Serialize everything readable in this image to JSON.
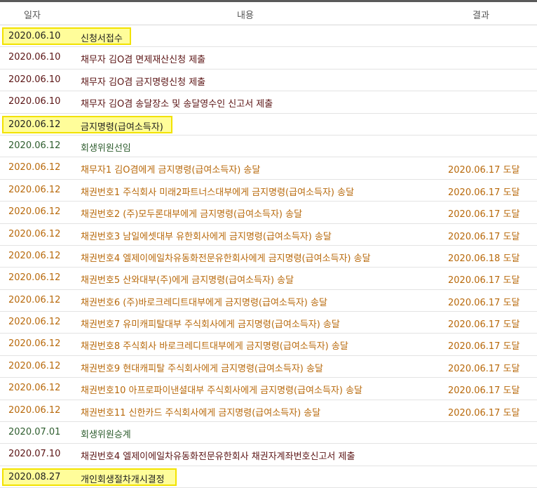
{
  "header": {
    "date": "일자",
    "content": "내용",
    "result": "결과"
  },
  "rows": [
    {
      "date": "2020.06.10",
      "content": "신청서접수",
      "result": "",
      "type": "hl"
    },
    {
      "date": "2020.06.10",
      "content": "채무자 김O겸 면제재산신청 제출",
      "result": "",
      "type": "dark"
    },
    {
      "date": "2020.06.10",
      "content": "채무자 김O겸 금지명령신청 제출",
      "result": "",
      "type": "dark"
    },
    {
      "date": "2020.06.10",
      "content": "채무자 김O겸 송달장소 및 송달영수인 신고서 제출",
      "result": "",
      "type": "dark"
    },
    {
      "date": "2020.06.12",
      "content": "금지명령(급여소득자)",
      "result": "",
      "type": "hl"
    },
    {
      "date": "2020.06.12",
      "content": "회생위원선임",
      "result": "",
      "type": "green"
    },
    {
      "date": "2020.06.12",
      "content": "채무자1 김O겸에게 금지명령(급여소득자) 송달",
      "result": "2020.06.17 도달",
      "type": "orange"
    },
    {
      "date": "2020.06.12",
      "content": "채권번호1 주식회사 미래2파트너스대부에게 금지명령(급여소득자) 송달",
      "result": "2020.06.17 도달",
      "type": "orange"
    },
    {
      "date": "2020.06.12",
      "content": "채권번호2 (주)모두론대부에게 금지명령(급여소득자) 송달",
      "result": "2020.06.17 도달",
      "type": "orange"
    },
    {
      "date": "2020.06.12",
      "content": "채권번호3 남일에셋대부 유한회사에게 금지명령(급여소득자) 송달",
      "result": "2020.06.17 도달",
      "type": "orange"
    },
    {
      "date": "2020.06.12",
      "content": "채권번호4 엘제이에일차유동화전문유한회사에게 금지명령(급여소득자) 송달",
      "result": "2020.06.18 도달",
      "type": "orange"
    },
    {
      "date": "2020.06.12",
      "content": "채권번호5 산와대부(주)에게 금지명령(급여소득자) 송달",
      "result": "2020.06.17 도달",
      "type": "orange"
    },
    {
      "date": "2020.06.12",
      "content": "채권번호6 (주)바로크레디트대부에게 금지명령(급여소득자) 송달",
      "result": "2020.06.17 도달",
      "type": "orange"
    },
    {
      "date": "2020.06.12",
      "content": "채권번호7 유미캐피탈대부 주식회사에게 금지명령(급여소득자) 송달",
      "result": "2020.06.17 도달",
      "type": "orange"
    },
    {
      "date": "2020.06.12",
      "content": "채권번호8 주식회사 바로크레디트대부에게 금지명령(급여소득자) 송달",
      "result": "2020.06.17 도달",
      "type": "orange"
    },
    {
      "date": "2020.06.12",
      "content": "채권번호9 현대캐피탈 주식회사에게 금지명령(급여소득자) 송달",
      "result": "2020.06.17 도달",
      "type": "orange"
    },
    {
      "date": "2020.06.12",
      "content": "채권번호10 아프로파이낸셜대부 주식회사에게 금지명령(급여소득자) 송달",
      "result": "2020.06.17 도달",
      "type": "orange"
    },
    {
      "date": "2020.06.12",
      "content": "채권번호11 신한카드 주식회사에게 금지명령(급여소득자) 송달",
      "result": "2020.06.17 도달",
      "type": "orange"
    },
    {
      "date": "2020.07.01",
      "content": "회생위원승계",
      "result": "",
      "type": "green"
    },
    {
      "date": "2020.07.10",
      "content": "채권번호4 엘제이에일차유동화전문유한회사 채권자계좌번호신고서 제출",
      "result": "",
      "type": "dark"
    },
    {
      "date": "2020.08.27",
      "content": "개인회생절차개시결정",
      "result": "",
      "type": "hl"
    }
  ],
  "colors": {
    "highlight_bg": "#fffd9a",
    "highlight_border": "#f2e200",
    "dark_text": "#5b1414",
    "green_text": "#2e5d2e",
    "orange_text": "#b8690b"
  }
}
